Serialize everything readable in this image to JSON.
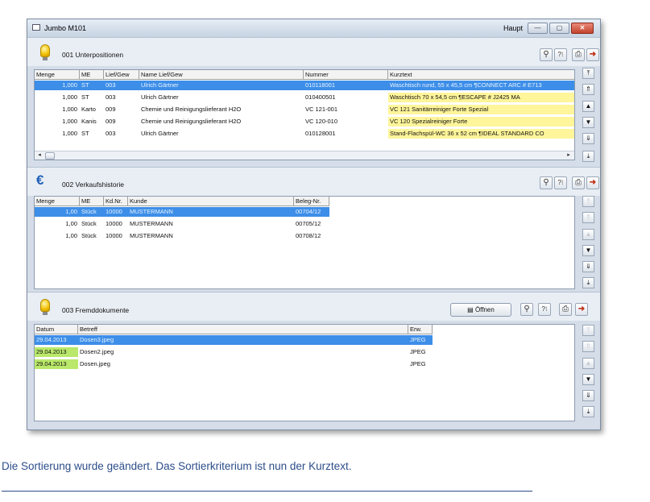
{
  "window": {
    "title": "Jumbo M101",
    "context_label": "Haupt",
    "buttons": {
      "minimize_glyph": "—",
      "maximize_glyph": "▢",
      "close_glyph": "✕"
    }
  },
  "toolbar_icons": {
    "find": "binoculars-icon",
    "help": "help-icon",
    "print": "print-icon",
    "exit": "exit-icon"
  },
  "panel1": {
    "title": "001 Unterpositionen",
    "columns": [
      "Menge",
      "ME",
      "Lief/Gew",
      "Name Lief/Gew",
      "Nummer",
      "Kurztext"
    ],
    "rows": [
      [
        "1,000",
        "ST",
        "003",
        "Ulrich Gärtner",
        "010118001",
        "Waschtisch rund, 55 x 45,5 cm ¶CONNECT ARC # E713"
      ],
      [
        "1,000",
        "ST",
        "003",
        "Ulrich Gärtner",
        "010400501",
        "Waschtisch  70 x 54,5 cm ¶ESCAPE # J2425 MA"
      ],
      [
        "1,000",
        "Karto",
        "009",
        "Chemie und Reinigungslieferant H2O",
        "VC 121-001",
        "VC 121 Sanitärreiniger Forte Spezial"
      ],
      [
        "1,000",
        "Kanis",
        "009",
        "Chemie und Reinigungslieferant H2O",
        "VC 120-010",
        "VC 120 Spezialreiniger Forte"
      ],
      [
        "1,000",
        "ST",
        "003",
        "Ulrich Gärtner",
        "010128001",
        "Stand-Flachspül-WC 36 x 52 cm ¶IDEAL STANDARD CO"
      ]
    ],
    "selected_row": 0,
    "scroll_left": "◂",
    "scroll_right": "▸"
  },
  "panel2": {
    "title": "002 Verkaufshistorie",
    "columns": [
      "Menge",
      "ME",
      "Kd.Nr.",
      "Kunde",
      "Beleg-Nr."
    ],
    "rows": [
      [
        "1,00",
        "Stück",
        "10000",
        "MUSTERMANN",
        "00704/12"
      ],
      [
        "1,00",
        "Stück",
        "10000",
        "MUSTERMANN",
        "00705/12"
      ],
      [
        "1,00",
        "Stück",
        "10000",
        "MUSTERMANN",
        "00708/12"
      ]
    ],
    "selected_row": 0
  },
  "panel3": {
    "title": "003 Fremddokumente",
    "open_button": "Öffnen",
    "columns": [
      "Datum",
      "Betreff",
      "Erw."
    ],
    "rows": [
      [
        "29.04.2013",
        "Dosen3.jpeg",
        "JPEG"
      ],
      [
        "29.04.2013",
        "Dosen2.jpeg",
        "JPEG"
      ],
      [
        "29.04.2013",
        "Dosen.jpeg",
        "JPEG"
      ]
    ],
    "selected_row": 0
  },
  "nav_glyphs": {
    "first": "⤒",
    "prev_page": "⇑",
    "prev": "▲",
    "next": "▼",
    "next_page": "⇓",
    "last": "⤓"
  },
  "caption": "Die Sortierung wurde geändert. Das Sortierkriterium ist nun der Kurztext."
}
